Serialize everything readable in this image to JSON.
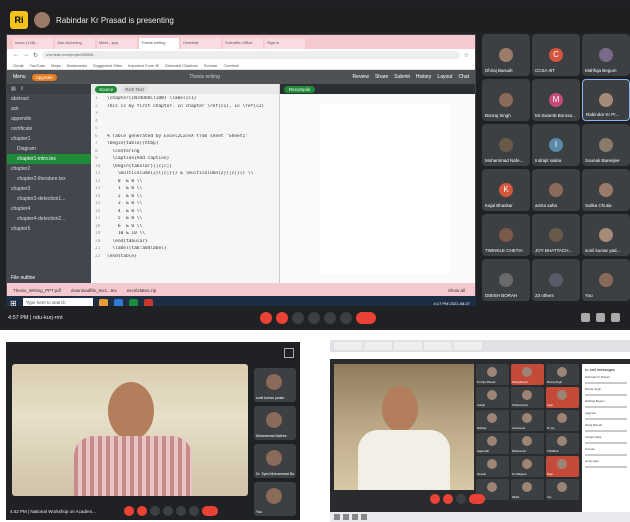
{
  "top": {
    "banner_badge": "Ri",
    "banner_text": "Rabindar Kr Prasad is presenting",
    "browser_tabs": [
      "Inbox (128) -",
      "Join Archiving",
      "Meet - zpq",
      "Thesis writing",
      "Overleaf",
      "Scientific Office",
      "Sign in"
    ],
    "url": "overleaf.com/project/5f8f4f...",
    "bookmarks": [
      "Gmail",
      "YouTube",
      "Maps",
      "Bookmarks",
      "Suggested Sites",
      "Imported From IE",
      "Detected Citations",
      "Scholar",
      "Overleaf"
    ],
    "overleaf": {
      "menu": "Menu",
      "upgrade": "Upgrade",
      "project_title": "Thesis writing",
      "actions": [
        "Review",
        "Share",
        "Submit",
        "History",
        "Layout",
        "Chat"
      ]
    },
    "file_tree": [
      "abstract",
      "ack",
      "appendix",
      "certificate",
      "chapter1",
      "Diagram",
      "chapter1-intro.tex",
      "chapter2",
      "chapter2-literature.tex",
      "chapter3",
      "chapter3-detection1...",
      "chapter4",
      "chapter4-detection2...",
      "chapter5"
    ],
    "file_tree_outline": "File outline",
    "editor_tabs": [
      "Source",
      "Rich Text"
    ],
    "code_lines": [
      "\\chapter{INTRODUCTION} \\label{c1}",
      "This is my first chapter. In chapter \\ref{c1}, In \\ref{c2}",
      "",
      "",
      "",
      "% Table generated by Excel2LaTeX from sheet 'Sheet1'",
      "\\begin{table}[htbp]",
      "  \\centering",
      "  \\caption{Add caption}",
      "  \\begin{tabular}{|c|c|}",
      "    \\multicolumn{2}{|c|}{} & \\multicolumn{2}{|c|}{} \\\\",
      "    0  & 0 \\\\",
      "    1  & 0 \\\\",
      "    2  & 0 \\\\",
      "    3  & 0 \\\\",
      "    4  & 0 \\\\",
      "    5  & 0 \\\\",
      "    6  & 0 \\\\",
      "    10 & 10 \\\\",
      "  \\end{tabular}",
      "  \\label{tab:addlabel}",
      "\\end{table}"
    ],
    "recompile": "Recompile",
    "downloads": [
      "Thesis_Writing_PPT.pdf",
      "downloadfile_tex1...tex",
      "excel2latex.zip",
      "Show all"
    ],
    "search_placeholder": "Type here to search",
    "taskbar_clock": "4:17 PM 2021-08-07",
    "participants": [
      {
        "name": "Dhiraj Baruah"
      },
      {
        "name": "CCSA IIIT",
        "initial": "C"
      },
      {
        "name": "Mahfuja Begum"
      },
      {
        "name": "Bonraj Singh"
      },
      {
        "name": "Mr.Swarnb Borosa...",
        "initial": "M"
      },
      {
        "name": "Rabindar Kr Pr..."
      },
      {
        "name": "Mohammad Nafe..."
      },
      {
        "name": "Indrajit saikia",
        "initial": "I"
      },
      {
        "name": "Sounak Banerjee"
      },
      {
        "name": "Kajal Bhaskar",
        "initial": "K"
      },
      {
        "name": "amita saha"
      },
      {
        "name": "Sulika Chutia"
      },
      {
        "name": "TWINKLE CHETIA"
      },
      {
        "name": "JOY BHATTACH..."
      },
      {
        "name": "sunil kumar yad..."
      },
      {
        "name": "DIBISH BORAH"
      },
      {
        "name": "23 others"
      },
      {
        "name": "You"
      }
    ],
    "meet_time": "4:57 PM  |  ndu-kurj-rmt"
  },
  "bottom_left": {
    "time_label": "4:42 PM | National Workshop on Academ...",
    "side_names": [
      "sunil kumar yadav",
      "Mohammad Nafees",
      "Dr. Syed Mohammad Bashir",
      "You"
    ]
  },
  "bottom_right": {
    "chat_title": "In-call messages",
    "chat_names": [
      "Rabindar Kr Prasad",
      "Bonraj Singh",
      "Mahfuja Begum",
      "Jagpreet",
      "Dhiraj Baruah",
      "Indrajit saikia",
      "Sounak",
      "amita saha"
    ],
    "tile_names": [
      "Dr Arjun Baruah",
      "Dhiraj Baruah",
      "Bonraj Singh",
      "Indrajit",
      "Prabal Kumar",
      "Kajal",
      "Mahfuja",
      "sunil kumar",
      "Dr Joy",
      "Jagannath",
      "Mohammad",
      "TWINKLE",
      "Sounak",
      "Dr Nabajyoti",
      "Bisal",
      "Amita",
      "Dibish",
      "You"
    ]
  },
  "colors": {
    "meet_bg": "#202124",
    "accent_green": "#1f8a37",
    "leave_red": "#ea4335",
    "download_bar": "#f6c9d0"
  }
}
